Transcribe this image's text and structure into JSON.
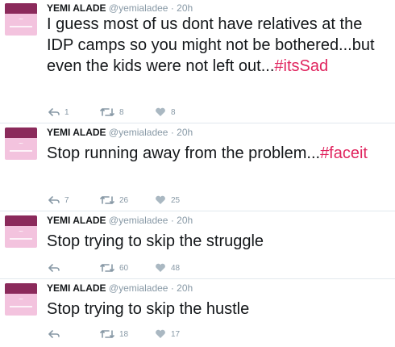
{
  "tweets": [
    {
      "name": "YEMI ALADE",
      "handle": "@yemialadee",
      "sep": "·",
      "time": "20h",
      "text": "I guess most of us dont have relatives at the IDP camps so you might not be bothered...but even the kids were not left out...",
      "hashtag": "#itsSad",
      "replies": "1",
      "retweets": "8",
      "likes": "8"
    },
    {
      "name": "YEMI ALADE",
      "handle": "@yemialadee",
      "sep": "·",
      "time": "20h",
      "text": "Stop running away from the problem...",
      "hashtag": "#faceit",
      "replies": "7",
      "retweets": "26",
      "likes": "25"
    },
    {
      "name": "YEMI ALADE",
      "handle": "@yemialadee",
      "sep": "·",
      "time": "20h",
      "text": "Stop trying to skip the struggle",
      "hashtag": "",
      "replies": "",
      "retweets": "60",
      "likes": "48"
    },
    {
      "name": "YEMI ALADE",
      "handle": "@yemialadee",
      "sep": "·",
      "time": "20h",
      "text": "Stop trying to skip the hustle",
      "hashtag": "",
      "replies": "",
      "retweets": "18",
      "likes": "17"
    }
  ],
  "icons": {
    "reply": "reply-icon",
    "retweet": "retweet-icon",
    "like": "heart-icon"
  },
  "colors": {
    "hashtag": "#e0245e",
    "meta": "#8899a6",
    "avatar_bg": "#f3c3de",
    "avatar_band": "#8b2a5b"
  }
}
